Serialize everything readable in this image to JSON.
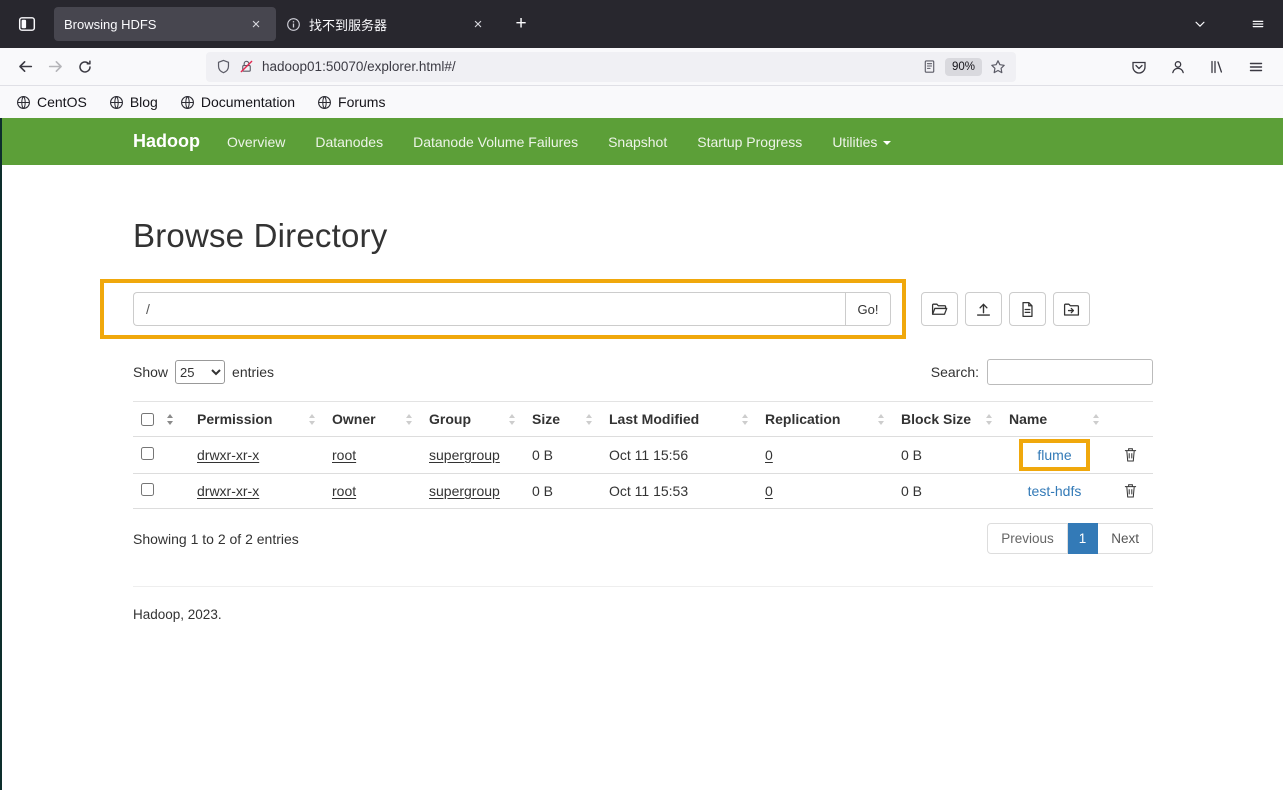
{
  "titlebar": {
    "tabs": [
      {
        "title": "Browsing HDFS"
      },
      {
        "title": "找不到服务器"
      }
    ],
    "close_glyph": "×",
    "new_tab_glyph": "+"
  },
  "toolbar": {
    "url": "hadoop01:50070/explorer.html#/",
    "zoom": "90%"
  },
  "bookmarks": {
    "items": [
      "CentOS",
      "Blog",
      "Documentation",
      "Forums"
    ]
  },
  "navbar": {
    "brand": "Hadoop",
    "items": [
      {
        "label": "Overview"
      },
      {
        "label": "Datanodes"
      },
      {
        "label": "Datanode Volume Failures"
      },
      {
        "label": "Snapshot"
      },
      {
        "label": "Startup Progress"
      },
      {
        "label": "Utilities"
      }
    ]
  },
  "page": {
    "title": "Browse Directory",
    "path": {
      "value": "/",
      "go": "Go!"
    },
    "length_menu": {
      "show": "Show",
      "selected": "25",
      "entries": "entries"
    },
    "search_label": "Search:",
    "table": {
      "headers": {
        "permission": "Permission",
        "owner": "Owner",
        "group": "Group",
        "size": "Size",
        "modified": "Last Modified",
        "replication": "Replication",
        "block_size": "Block Size",
        "name": "Name"
      },
      "rows": [
        {
          "permission": "drwxr-xr-x",
          "owner": "root",
          "group": "supergroup",
          "size": "0 B",
          "modified": "Oct 11 15:56",
          "replication": "0",
          "block_size": "0 B",
          "name": "flume"
        },
        {
          "permission": "drwxr-xr-x",
          "owner": "root",
          "group": "supergroup",
          "size": "0 B",
          "modified": "Oct 11 15:53",
          "replication": "0",
          "block_size": "0 B",
          "name": "test-hdfs"
        }
      ]
    },
    "info": "Showing 1 to 2 of 2 entries",
    "pagination": {
      "previous": "Previous",
      "page": "1",
      "next": "Next"
    },
    "footer": "Hadoop, 2023.",
    "highlight_color": "#f0a80c",
    "link_color": "#337ab7"
  }
}
